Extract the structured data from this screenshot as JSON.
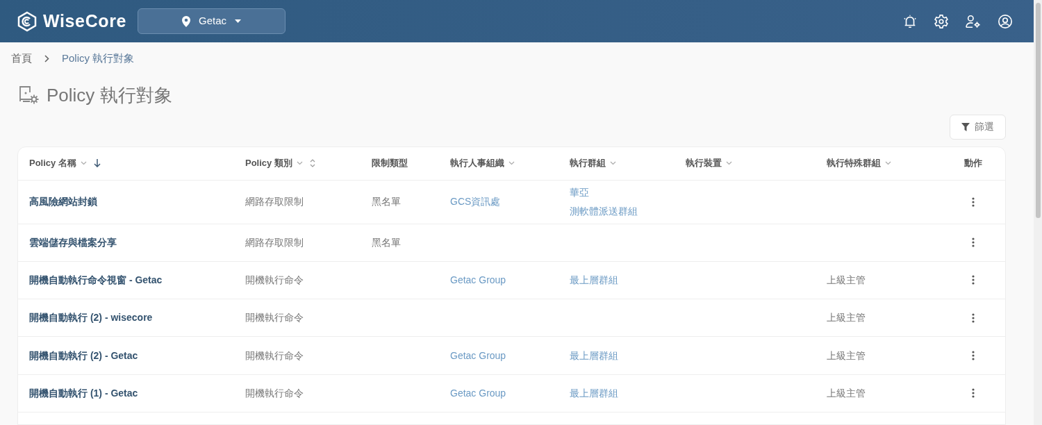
{
  "header": {
    "logo": "WiseCore",
    "site_selector": {
      "value": "Getac"
    }
  },
  "breadcrumb": [
    "首頁",
    "Policy 執行對象"
  ],
  "page_title": "Policy 執行對象",
  "filter_button": "篩選",
  "table": {
    "columns": [
      {
        "label": "Policy 名稱",
        "filter": true,
        "sorted": true
      },
      {
        "label": "Policy 類別",
        "filter": true,
        "sorted": false
      },
      {
        "label": "限制類型",
        "filter": false
      },
      {
        "label": "執行人事組織",
        "filter": true
      },
      {
        "label": "執行群組",
        "filter": true
      },
      {
        "label": "執行裝置",
        "filter": true
      },
      {
        "label": "執行特殊群組",
        "filter": true
      },
      {
        "label": "動作",
        "filter": false
      }
    ],
    "rows": [
      {
        "name": "高風險網站封鎖",
        "category": "網路存取限制",
        "restriction": "黑名單",
        "orgs": [
          "GCS資訊處"
        ],
        "groups": [
          "華亞",
          "測軟體派送群組"
        ],
        "special": ""
      },
      {
        "name": "雲端儲存與檔案分享",
        "category": "網路存取限制",
        "restriction": "黑名單",
        "orgs": [],
        "groups": [],
        "special": ""
      },
      {
        "name": "開機自動執行命令視窗 - Getac",
        "category": "開機執行命令",
        "restriction": "",
        "orgs": [
          "Getac Group"
        ],
        "groups": [
          "最上層群組"
        ],
        "special": "上級主管"
      },
      {
        "name": "開機自動執行 (2) - wisecore",
        "category": "開機執行命令",
        "restriction": "",
        "orgs": [],
        "groups": [],
        "special": "上級主管"
      },
      {
        "name": "開機自動執行 (2) - Getac",
        "category": "開機執行命令",
        "restriction": "",
        "orgs": [
          "Getac Group"
        ],
        "groups": [
          "最上層群組"
        ],
        "special": "上級主管"
      },
      {
        "name": "開機自動執行 (1) - Getac",
        "category": "開機執行命令",
        "restriction": "",
        "orgs": [
          "Getac Group"
        ],
        "groups": [
          "最上層群組"
        ],
        "special": "上級主管"
      }
    ]
  }
}
